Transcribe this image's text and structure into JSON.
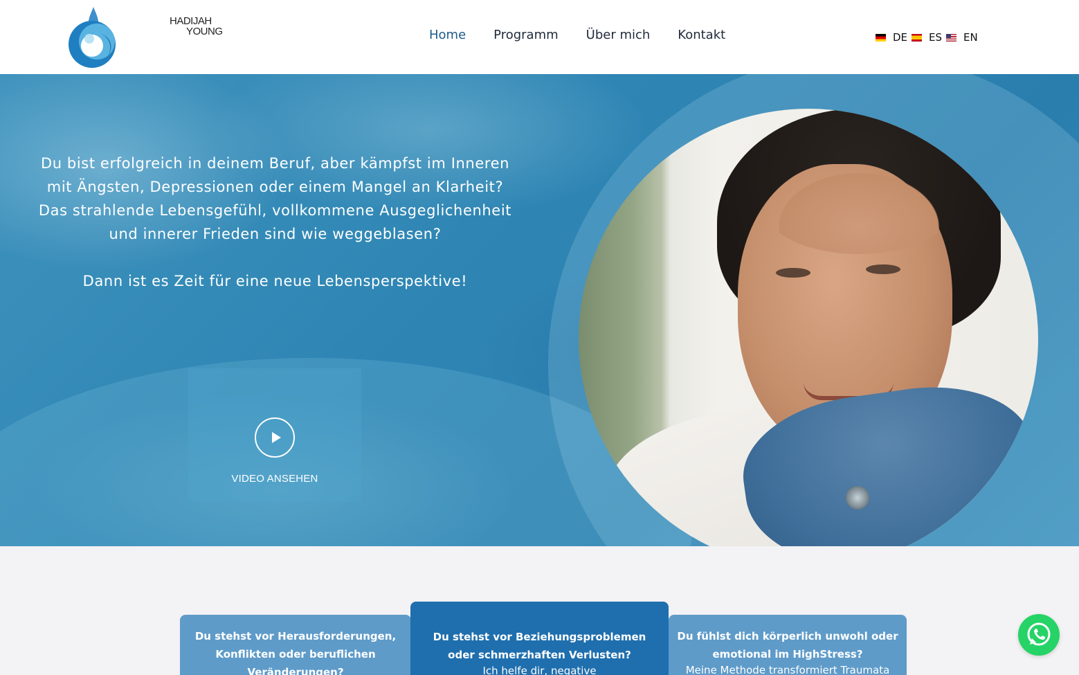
{
  "header": {
    "logo": {
      "line1": "HADIJAH",
      "line2": "YOUNG"
    },
    "nav": [
      {
        "label": "Home",
        "active": true
      },
      {
        "label": "Programm",
        "active": false
      },
      {
        "label": "Über mich",
        "active": false
      },
      {
        "label": "Kontakt",
        "active": false
      }
    ],
    "languages": [
      {
        "flag": "flag-germany-icon",
        "label": "DE"
      },
      {
        "flag": "flag-spain-icon",
        "label": "ES"
      },
      {
        "flag": "flag-usa-icon",
        "label": "EN"
      }
    ]
  },
  "hero": {
    "paragraph1": "Du bist erfolgreich in deinem Beruf, aber kämpfst im Inneren mit Ängsten, Depressionen oder einem Mangel an Klarheit?",
    "paragraph2": "Das strahlende Lebensgefühl, vollkommene Ausgeglichenheit und innerer Frieden sind wie weggeblasen?",
    "paragraph3": "Dann ist es Zeit für eine neue Lebensperspektive!",
    "video_label": "VIDEO ANSEHEN",
    "play_icon": "play-icon"
  },
  "cards": [
    {
      "title": "Du stehst vor Herausforderungen, Konflikten oder beruflichen Veränderungen?",
      "text": ""
    },
    {
      "title": "Du stehst vor Beziehungsproblemen oder schmerzhaften Verlusten?",
      "text": "Ich helfe dir, negative"
    },
    {
      "title": "Du fühlst dich körperlich unwohl oder emotional im HighStress?",
      "text": "Meine Methode transformiert Traumata"
    }
  ],
  "floating": {
    "icon": "whatsapp-icon"
  },
  "colors": {
    "nav_active": "#1d5a8a",
    "hero_blue": "#2f86b4",
    "card_light": "#5e9bc9",
    "card_dark": "#1f6fae",
    "whatsapp": "#25d366"
  }
}
